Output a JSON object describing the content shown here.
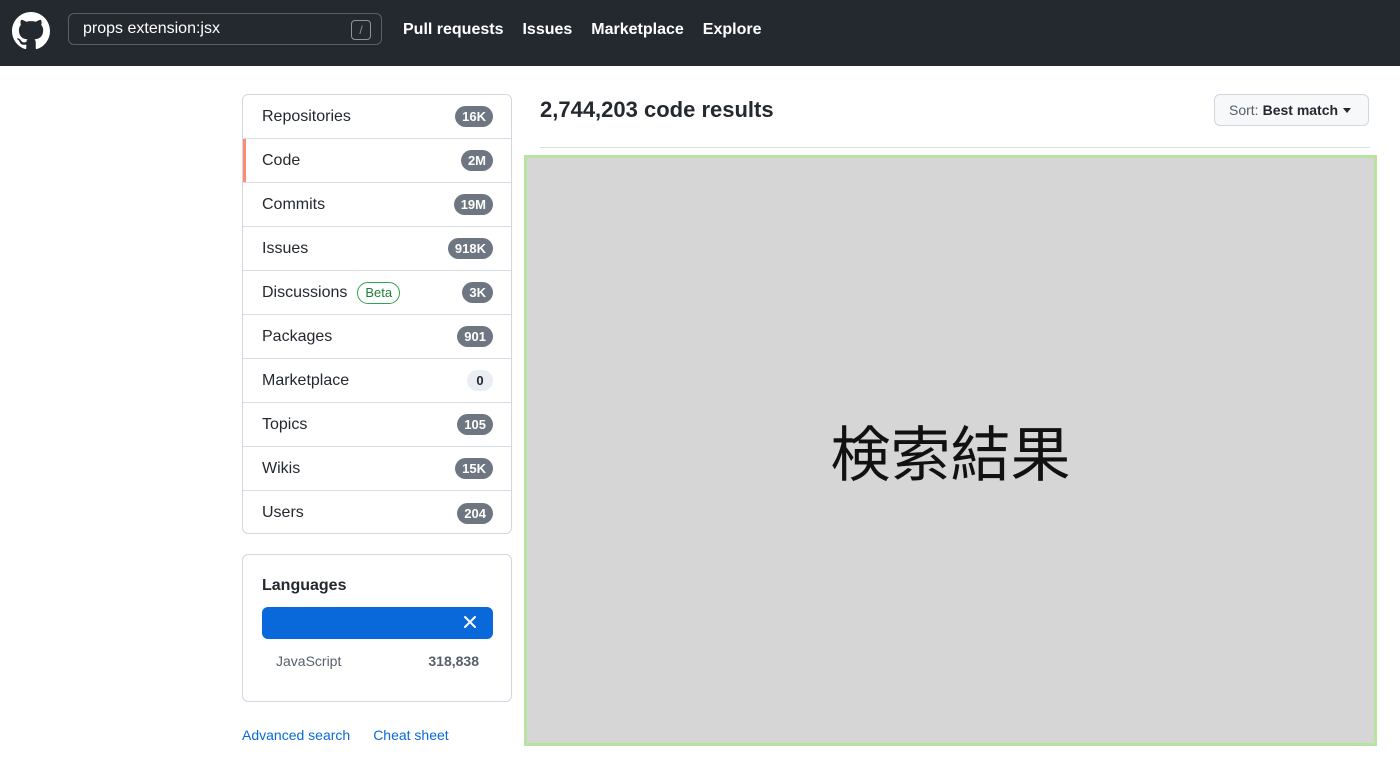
{
  "header": {
    "search_value": "props extension:jsx",
    "search_key_hint": "/",
    "nav": [
      "Pull requests",
      "Issues",
      "Marketplace",
      "Explore"
    ]
  },
  "sidebar": {
    "items": [
      {
        "label": "Repositories",
        "count": "16K",
        "selected": false
      },
      {
        "label": "Code",
        "count": "2M",
        "selected": true
      },
      {
        "label": "Commits",
        "count": "19M",
        "selected": false
      },
      {
        "label": "Issues",
        "count": "918K",
        "selected": false
      },
      {
        "label": "Discussions",
        "badge": "Beta",
        "count": "3K",
        "selected": false
      },
      {
        "label": "Packages",
        "count": "901",
        "selected": false
      },
      {
        "label": "Marketplace",
        "count": "0",
        "selected": false
      },
      {
        "label": "Topics",
        "count": "105",
        "selected": false
      },
      {
        "label": "Wikis",
        "count": "15K",
        "selected": false
      },
      {
        "label": "Users",
        "count": "204",
        "selected": false
      }
    ],
    "languages": {
      "title": "Languages",
      "language": "JavaScript",
      "count": "318,838"
    },
    "links": {
      "advanced_search": "Advanced search",
      "cheat_sheet": "Cheat sheet"
    }
  },
  "main": {
    "results_title": "2,744,203 code results",
    "sort_prefix": "Sort:",
    "sort_value": "Best match",
    "placeholder_text": "検索結果"
  },
  "colors": {
    "header_bg": "#24292f",
    "selected_accent": "#fd8c73",
    "language_bar": "#0969da",
    "link": "#0969da",
    "placeholder_bg": "#d6d6d6",
    "placeholder_border": "#b8e3a0"
  }
}
